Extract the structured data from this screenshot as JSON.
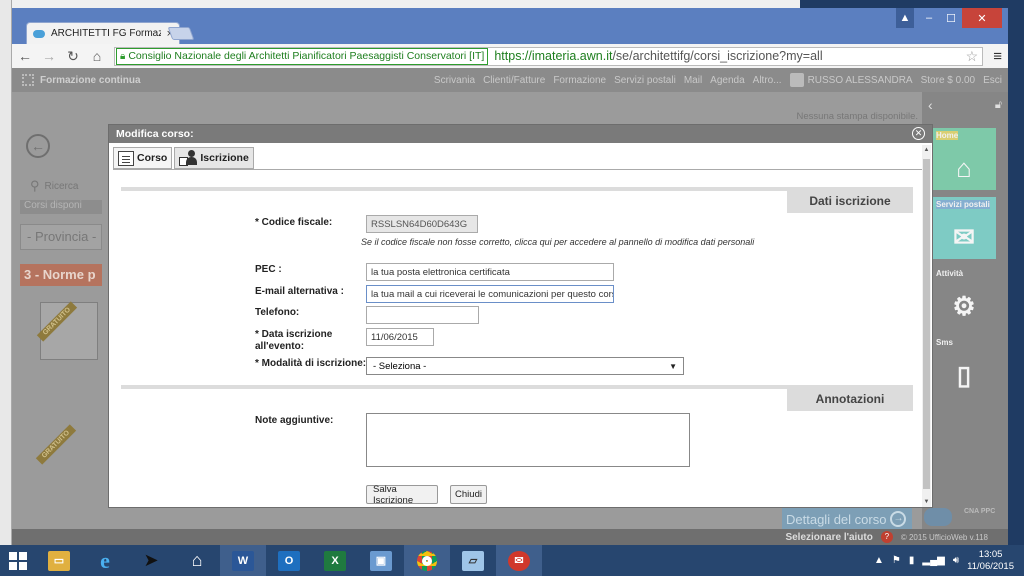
{
  "browser": {
    "tab_title": "ARCHITETTI FG Formazion",
    "tab_close": "×",
    "ev_label": "Consiglio Nazionale degli Architetti Pianificatori Paesaggisti Conservatori [IT]",
    "url_host": "https://imateria.awn.it",
    "url_path": "/se/architettifg/corsi_iscrizione?my=all",
    "window_buttons": {
      "minimize": "–",
      "maximize": "☐",
      "close": "✕"
    }
  },
  "app": {
    "brand": "Formazione continua",
    "nav": [
      "Scrivania",
      "Clienti/Fatture",
      "Formazione",
      "Servizi postali",
      "Mail",
      "Agenda",
      "Altro..."
    ],
    "user": "RUSSO ALESSANDRA",
    "store": "Store $ 0.00",
    "exit": "Esci",
    "nostampa": "Nessuna stampa disponibile.",
    "left": {
      "ricerca": "Ricerca",
      "corsi_disponibili": "Corsi disponi",
      "provincia": "- Provincia -",
      "norme": "3 - Norme p",
      "badge": "GRATUITO"
    },
    "tiles": [
      {
        "label": "Home",
        "icon": "home-icon",
        "color": "#7ec9a9"
      },
      {
        "label": "Servizi postali",
        "icon": "envelope-icon",
        "color": "#d9cf72"
      },
      {
        "label": "Attività",
        "icon": "gear-list-icon",
        "color": "#7ecbc4"
      },
      {
        "label": "Sms",
        "icon": "phone-icon",
        "color": "#84aed0"
      }
    ],
    "dettagli": "Dettagli del corso",
    "footer_help": "Selezionare l'aiuto",
    "footer_copy": "© 2015 UfficioWeb v.118",
    "cnappc_logo": "CNA PPC"
  },
  "modal": {
    "title": "Modifica corso:",
    "tabs": [
      "Corso",
      "Iscrizione"
    ],
    "section_iscrizione": "Dati iscrizione",
    "section_annotazioni": "Annotazioni",
    "codice_fiscale_label": "* Codice fiscale:",
    "codice_fiscale_value": "RSSLSN64D60D643G",
    "codice_hint": "Se il codice fiscale non fosse corretto, clicca qui per accedere al pannello di modifica dati personali",
    "pec_label": "PEC :",
    "pec_value": "la tua posta elettronica certificata",
    "email_label": "E-mail alternativa :",
    "email_value": "la tua mail a cui riceverai le comunicazioni per questo corso",
    "telefono_label": "Telefono:",
    "telefono_value": "",
    "data_label_1": "* Data iscrizione",
    "data_label_2": "all'evento:",
    "data_value": "11/06/2015",
    "modalita_label": "* Modalità di iscrizione:",
    "modalita_value": "- Seleziona -",
    "note_label": "Note aggiuntive:",
    "btn_salva": "Salva Iscrizione",
    "btn_chiudi": "Chiudi"
  },
  "taskbar": {
    "time": "13:05",
    "date": "11/06/2015",
    "apps": [
      "file-explorer-icon",
      "internet-explorer-icon",
      "app-icon",
      "home-icon",
      "word-icon",
      "outlook-icon",
      "excel-icon",
      "remote-desktop-icon",
      "chrome-icon",
      "notepad-icon",
      "mail-icon"
    ]
  }
}
